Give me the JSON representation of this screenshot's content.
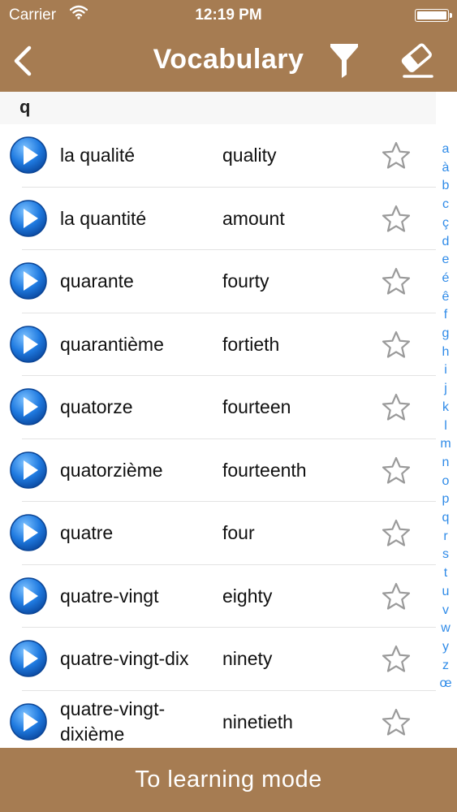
{
  "status": {
    "carrier": "Carrier",
    "time": "12:19 PM"
  },
  "nav": {
    "title": "Vocabulary"
  },
  "section": {
    "letter": "q"
  },
  "rows": [
    {
      "french": "la qualité",
      "english": "quality"
    },
    {
      "french": "la quantité",
      "english": "amount"
    },
    {
      "french": "quarante",
      "english": "fourty"
    },
    {
      "french": "quarantième",
      "english": "fortieth"
    },
    {
      "french": "quatorze",
      "english": "fourteen"
    },
    {
      "french": "quatorzième",
      "english": "fourteenth"
    },
    {
      "french": "quatre",
      "english": "four"
    },
    {
      "french": "quatre-vingt",
      "english": "eighty"
    },
    {
      "french": "quatre-vingt-dix",
      "english": "ninety"
    },
    {
      "french": "quatre-vingt-dixième",
      "english": "ninetieth"
    }
  ],
  "index": [
    "a",
    "à",
    "b",
    "c",
    "ç",
    "d",
    "e",
    "é",
    "ê",
    "f",
    "g",
    "h",
    "i",
    "j",
    "k",
    "l",
    "m",
    "n",
    "o",
    "p",
    "q",
    "r",
    "s",
    "t",
    "u",
    "v",
    "w",
    "y",
    "z",
    "œ"
  ],
  "bottom": {
    "label": "To learning mode"
  },
  "colors": {
    "brand": "#a67c52",
    "index": "#2f8be8",
    "play": "#1a6fd6"
  }
}
